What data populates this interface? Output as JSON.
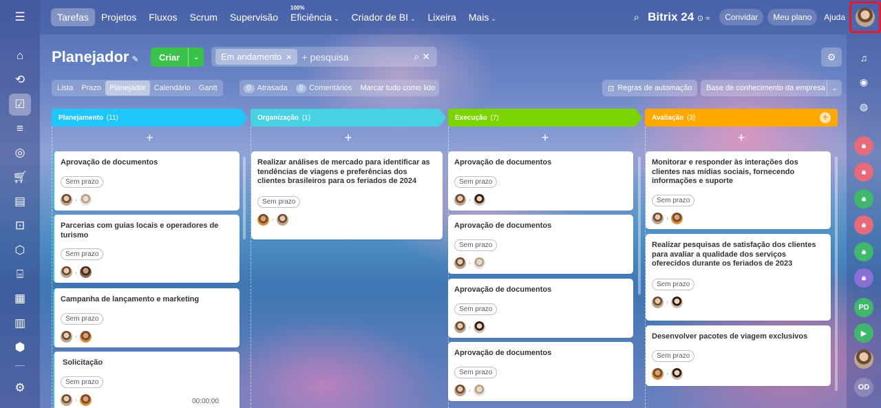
{
  "topbar": {
    "menu_icon": "hamburger-icon",
    "nav": [
      {
        "label": "Tarefas",
        "active": true
      },
      {
        "label": "Projetos"
      },
      {
        "label": "Fluxos"
      },
      {
        "label": "Scrum"
      },
      {
        "label": "Supervisão"
      },
      {
        "label": "Eficiência",
        "badge": "100%",
        "dropdown": true
      },
      {
        "label": "Criador de BI",
        "dropdown": true
      },
      {
        "label": "Lixeira"
      },
      {
        "label": "Mais",
        "dropdown": true
      }
    ],
    "brand": "Bitrix 24",
    "invite": "Convidar",
    "my_plan": "Meu plano",
    "help": "Ajuda"
  },
  "page": {
    "title": "Planejador",
    "create_label": "Criar",
    "filter_chip": "Em andamento",
    "search_placeholder": "+ pesquisa",
    "views": [
      "Lista",
      "Prazo",
      "Planejador",
      "Calendário",
      "Gantt"
    ],
    "active_view": "Planejador",
    "counters": [
      {
        "count": "0",
        "label": "Atrasada"
      },
      {
        "count": "0",
        "label": "Comentários"
      }
    ],
    "mark_all_read": "Marcar tudo como lido",
    "automation_rules": "Regras de automação",
    "knowledge_base": "Base de conhecimento da empresa"
  },
  "columns": [
    {
      "title": "Planejamento",
      "count": "(11)",
      "color": "#1ec6fa",
      "cards": [
        {
          "title": "Aprovação de documentos",
          "deadline": "Sem prazo"
        },
        {
          "title": "Parcerias com guias locais e operadores de turismo",
          "deadline": "Sem prazo"
        },
        {
          "title": "Campanha de lançamento e marketing",
          "deadline": "Sem prazo"
        },
        {
          "title": "Solicitação",
          "deadline": "Sem prazo",
          "timer": "00:00:00"
        }
      ]
    },
    {
      "title": "Organização",
      "count": "(1)",
      "color": "#47d1e2",
      "cards": [
        {
          "title": "Realizar análises de mercado para identificar as tendências de viagens e preferências dos clientes brasileiros para os feriados de 2024",
          "deadline": "Sem prazo"
        }
      ]
    },
    {
      "title": "Execução",
      "count": "(7)",
      "color": "#7bd500",
      "cards": [
        {
          "title": "Aprovação de documentos",
          "deadline": "Sem prazo"
        },
        {
          "title": "Aprovação de documentos",
          "deadline": "Sem prazo"
        },
        {
          "title": "Aprovação de documentos",
          "deadline": "Sem prazo"
        },
        {
          "title": "Aprovação de documentos",
          "deadline": "Sem prazo"
        }
      ]
    },
    {
      "title": "Avaliação",
      "count": "(3)",
      "color": "#ffa900",
      "cards": [
        {
          "title": "Monitorar e responder às interações dos clientes nas mídias sociais, fornecendo informações e suporte",
          "deadline": "Sem prazo"
        },
        {
          "title": "Realizar pesquisas de satisfação dos clientes para avaliar a qualidade dos serviços oferecidos durante os feriados de 2023",
          "deadline": "Sem prazo"
        },
        {
          "title": "Desenvolver pacotes de viagem exclusivos",
          "deadline": "Sem prazo"
        }
      ]
    }
  ],
  "right_bar": {
    "badges": [
      "PD",
      "OD"
    ]
  }
}
